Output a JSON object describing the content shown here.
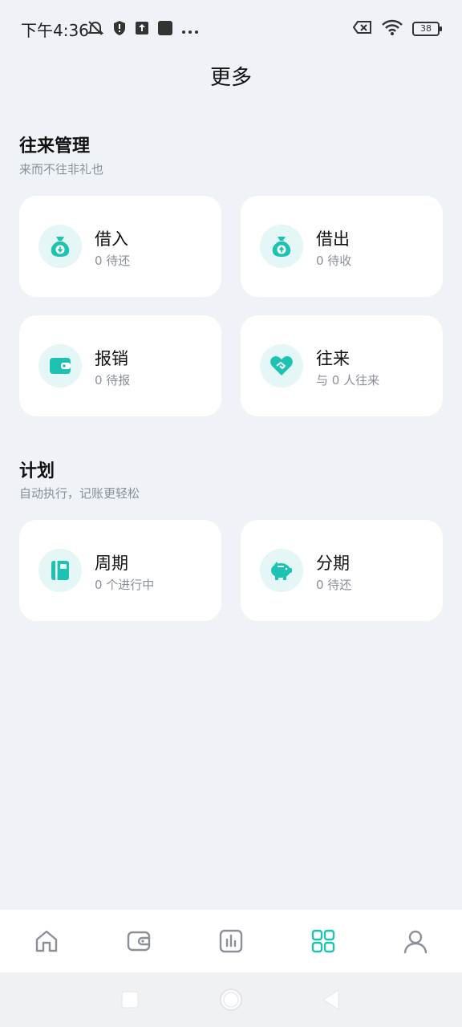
{
  "status": {
    "time": "下午4:36",
    "battery": "38"
  },
  "page": {
    "title": "更多"
  },
  "sections": [
    {
      "title": "往来管理",
      "subtitle": "来而不往非礼也",
      "cards": [
        {
          "title": "借入",
          "sub": "0 待还",
          "icon": "money-bag-down-icon"
        },
        {
          "title": "借出",
          "sub": "0 待收",
          "icon": "money-bag-up-icon"
        },
        {
          "title": "报销",
          "sub": "0 待报",
          "icon": "wallet-icon"
        },
        {
          "title": "往来",
          "sub": "与 0 人往来",
          "icon": "heart-handshake-icon"
        }
      ]
    },
    {
      "title": "计划",
      "subtitle": "自动执行，记账更轻松",
      "cards": [
        {
          "title": "周期",
          "sub": "0 个进行中",
          "icon": "book-icon"
        },
        {
          "title": "分期",
          "sub": "0 待还",
          "icon": "piggy-bank-icon"
        }
      ]
    }
  ],
  "tabbar": {
    "items": [
      "home-icon",
      "wallet-icon",
      "chart-icon",
      "grid-icon",
      "user-icon"
    ],
    "active": 3
  },
  "colors": {
    "accent": "#1cc3b2",
    "background": "#eff3f8",
    "card": "#ffffff",
    "inactive": "#8a8f98"
  }
}
